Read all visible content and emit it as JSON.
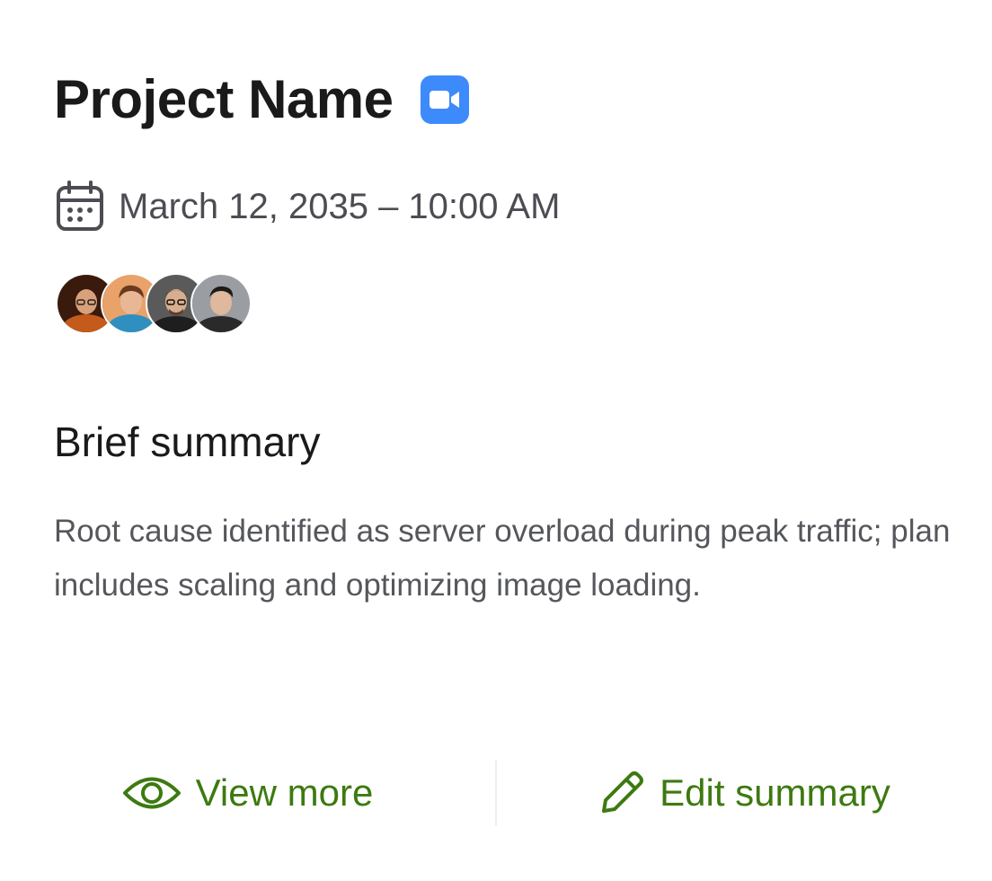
{
  "card": {
    "title": "Project Name",
    "meeting_icon": "zoom-video-icon",
    "date_icon": "calendar-icon",
    "date": "March 12, 2035 – 10:00 AM",
    "participants": [
      {
        "name": "participant-1",
        "color": "#c45a1c"
      },
      {
        "name": "participant-2",
        "color": "#e8a26a"
      },
      {
        "name": "participant-3",
        "color": "#3b3b3b"
      },
      {
        "name": "participant-4",
        "color": "#7a7d82"
      }
    ],
    "summary_heading": "Brief summary",
    "summary_text": "Root cause identified as server overload during peak traffic; plan includes scaling and optimizing image loading.",
    "actions": {
      "view_more_label": "View more",
      "view_more_icon": "eye-icon",
      "edit_summary_label": "Edit summary",
      "edit_summary_icon": "pencil-icon"
    }
  },
  "colors": {
    "accent_green": "#3d7a10",
    "zoom_blue": "#3d8bfb",
    "title": "#1a1a1a",
    "muted_text": "#55575c"
  }
}
